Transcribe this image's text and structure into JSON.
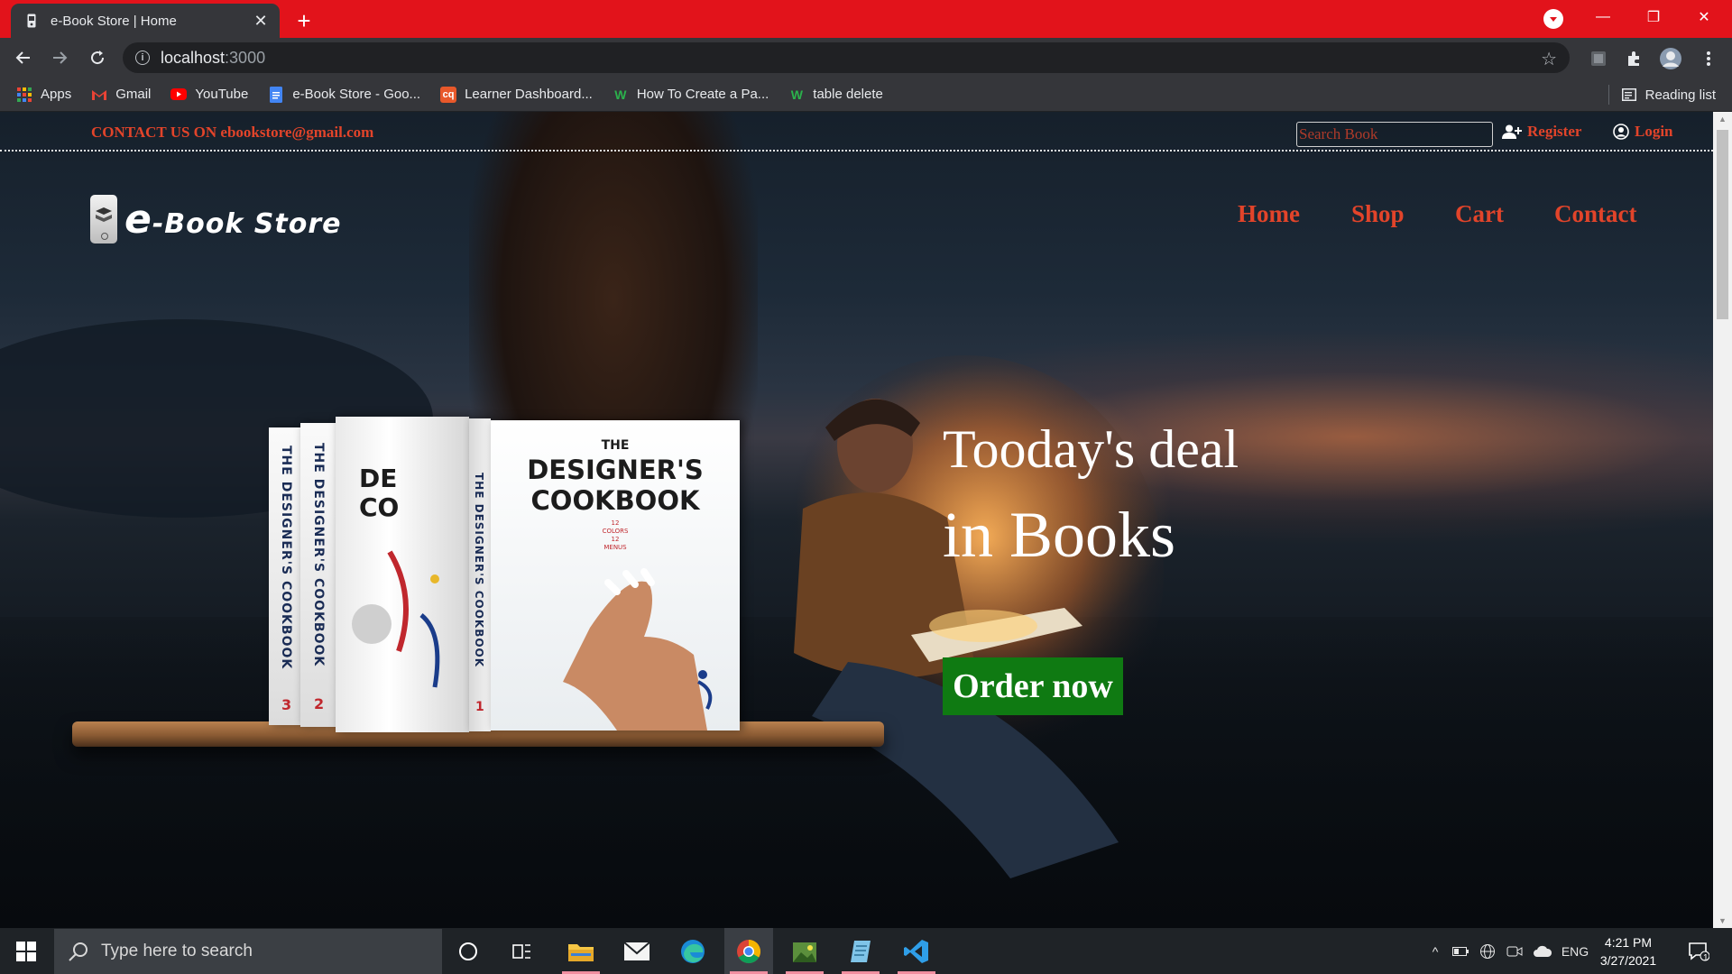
{
  "browser": {
    "tab_title": "e-Book Store | Home",
    "url_host": "localhost",
    "url_port": ":3000",
    "bookmarks": [
      {
        "label": "Apps",
        "icon": "apps-grid-icon"
      },
      {
        "label": "Gmail",
        "icon": "gmail-icon"
      },
      {
        "label": "YouTube",
        "icon": "youtube-icon"
      },
      {
        "label": "e-Book Store - Goo...",
        "icon": "google-docs-icon"
      },
      {
        "label": "Learner Dashboard...",
        "icon": "cq-icon"
      },
      {
        "label": "How To Create a Pa...",
        "icon": "w-icon"
      },
      {
        "label": "table delete",
        "icon": "w-icon"
      }
    ],
    "reading_list": "Reading list"
  },
  "page": {
    "contact": "CONTACT US ON ebookstore@gmail.com",
    "search_placeholder": "Search Book",
    "register": "Register",
    "login": "Login",
    "logo": {
      "e": "e",
      "rest": "-Book Store"
    },
    "nav": [
      "Home",
      "Shop",
      "Cart",
      "Contact"
    ],
    "hero_line1": "Tooday's deal",
    "hero_line2": "in Books",
    "order_button": "Order now",
    "book": {
      "cover_the": "THE",
      "cover_title_1": "DESIGNER'S",
      "cover_title_2": "COOKBOOK",
      "cover_sub": [
        "12",
        "COLORS",
        "12",
        "MENUS"
      ],
      "spine": "THE DESIGNER'S COOKBOOK",
      "partial_1": "DE",
      "partial_2": "CO",
      "numbers": [
        "1",
        "2",
        "3"
      ]
    }
  },
  "taskbar": {
    "search_placeholder": "Type here to search",
    "language": "ENG",
    "time": "4:21 PM",
    "date": "3/27/2021",
    "notifications": "1"
  },
  "colors": {
    "accent_red": "#e2442a",
    "chrome_red": "#e2131b",
    "order_green": "#0f7a12"
  }
}
